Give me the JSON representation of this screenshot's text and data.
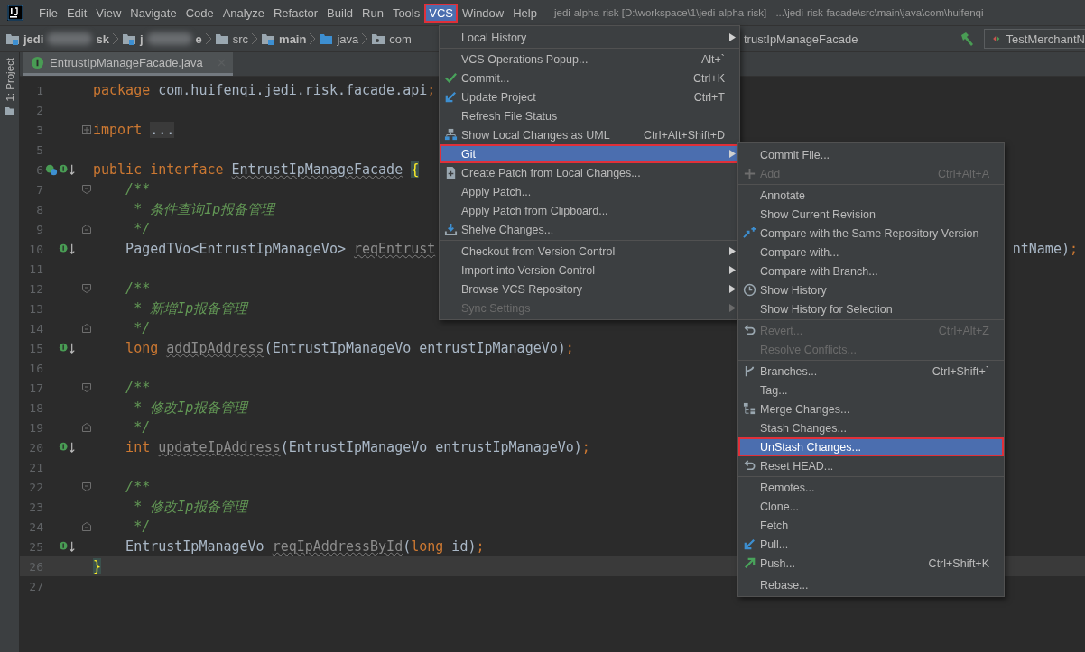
{
  "menubar": {
    "items": [
      {
        "label": "File",
        "selected": false,
        "marked": false
      },
      {
        "label": "Edit",
        "selected": false,
        "marked": false
      },
      {
        "label": "View",
        "selected": false,
        "marked": false
      },
      {
        "label": "Navigate",
        "selected": false,
        "marked": false
      },
      {
        "label": "Code",
        "selected": false,
        "marked": false
      },
      {
        "label": "Analyze",
        "selected": false,
        "marked": false
      },
      {
        "label": "Refactor",
        "selected": false,
        "marked": false
      },
      {
        "label": "Build",
        "selected": false,
        "marked": false
      },
      {
        "label": "Run",
        "selected": false,
        "marked": false
      },
      {
        "label": "Tools",
        "selected": false,
        "marked": false
      },
      {
        "label": "VCS",
        "selected": true,
        "marked": true
      },
      {
        "label": "Window",
        "selected": false,
        "marked": false
      },
      {
        "label": "Help",
        "selected": false,
        "marked": false
      }
    ],
    "title": "jedi-alpha-risk [D:\\workspace\\1\\jedi-alpha-risk] - ...\\jedi-risk-facade\\src\\main\\java\\com\\huifenqi"
  },
  "breadcrumbs": {
    "items": [
      {
        "kind": "module",
        "text": "jedi",
        "text_after": "sk",
        "redacted": true
      },
      {
        "kind": "module",
        "text": "j",
        "text_after": "e",
        "redacted": true
      },
      {
        "kind": "folder",
        "text": "src",
        "redacted": false
      },
      {
        "kind": "module",
        "text": "main",
        "redacted": false
      },
      {
        "kind": "source",
        "text": "java",
        "redacted": false
      },
      {
        "kind": "package",
        "text": "com",
        "redacted": false
      }
    ],
    "tail": "trustIpManageFacade",
    "run_config": "TestMerchantN"
  },
  "sidebar": {
    "tool_window": "1: Project"
  },
  "editor": {
    "tabs": [
      {
        "label": "EntrustIpManageFacade.java",
        "selected": true
      }
    ],
    "lines": [
      {
        "number": "1",
        "current": false,
        "tokens": [
          {
            "kind": "kw",
            "text": "package"
          },
          {
            "kind": "plain",
            "text": " com.huifenqi.jedi.risk.facade.api"
          },
          {
            "kind": "kw",
            "text": ";"
          }
        ]
      },
      {
        "number": "2",
        "current": false
      },
      {
        "number": "3",
        "current": false,
        "fold": {
          "kind": "collapsed"
        },
        "tokens": [
          {
            "kind": "kw",
            "text": "import "
          },
          {
            "kind": "folded",
            "text": "..."
          }
        ]
      },
      {
        "number": "5",
        "current": false
      },
      {
        "number": "6",
        "current": false,
        "gutter": [
          {
            "kind": "hierarchy"
          },
          {
            "kind": "implemented"
          }
        ],
        "tokens": [
          {
            "kind": "kw",
            "text": "public interface "
          },
          {
            "kind": "warn",
            "text": "EntrustIpManageFacade"
          },
          {
            "kind": "brace",
            "text": "{"
          }
        ]
      },
      {
        "number": "7",
        "current": false,
        "fold": {
          "kind": "open"
        },
        "tokens": [
          {
            "kind": "comment",
            "text": "    /**"
          }
        ]
      },
      {
        "number": "8",
        "current": false,
        "tokens": [
          {
            "kind": "comment",
            "text": "     * 条件查询Ip报备管理"
          }
        ]
      },
      {
        "number": "9",
        "current": false,
        "fold": {
          "kind": "close"
        },
        "tokens": [
          {
            "kind": "comment",
            "text": "     */"
          }
        ]
      },
      {
        "number": "10",
        "current": false,
        "gutter": [
          {
            "kind": "implemented"
          }
        ],
        "tokens": [
          {
            "kind": "plain",
            "text": "    PagedTVo<EntrustIpManageVo> "
          },
          {
            "kind": "unused",
            "text": "reqEntrust"
          }
        ],
        "tail": [
          {
            "kind": "plain",
            "text": "ntName)"
          },
          {
            "kind": "kw",
            "text": ";"
          }
        ]
      },
      {
        "number": "11",
        "current": false
      },
      {
        "number": "12",
        "current": false,
        "fold": {
          "kind": "open"
        },
        "tokens": [
          {
            "kind": "comment",
            "text": "    /**"
          }
        ]
      },
      {
        "number": "13",
        "current": false,
        "tokens": [
          {
            "kind": "comment",
            "text": "     * 新增Ip报备管理"
          }
        ]
      },
      {
        "number": "14",
        "current": false,
        "fold": {
          "kind": "close"
        },
        "tokens": [
          {
            "kind": "comment",
            "text": "     */"
          }
        ]
      },
      {
        "number": "15",
        "current": false,
        "gutter": [
          {
            "kind": "implemented"
          }
        ],
        "tokens": [
          {
            "kind": "kw",
            "text": "    long "
          },
          {
            "kind": "unused",
            "text": "addIpAddress"
          },
          {
            "kind": "plain",
            "text": "(EntrustIpManageVo entrustIpManageVo)"
          },
          {
            "kind": "kw",
            "text": ";"
          }
        ]
      },
      {
        "number": "16",
        "current": false
      },
      {
        "number": "17",
        "current": false,
        "fold": {
          "kind": "open"
        },
        "tokens": [
          {
            "kind": "comment",
            "text": "    /**"
          }
        ]
      },
      {
        "number": "18",
        "current": false,
        "tokens": [
          {
            "kind": "comment",
            "text": "     * 修改Ip报备管理"
          }
        ]
      },
      {
        "number": "19",
        "current": false,
        "fold": {
          "kind": "close"
        },
        "tokens": [
          {
            "kind": "comment",
            "text": "     */"
          }
        ]
      },
      {
        "number": "20",
        "current": false,
        "gutter": [
          {
            "kind": "implemented"
          }
        ],
        "tokens": [
          {
            "kind": "kw",
            "text": "    int "
          },
          {
            "kind": "unused",
            "text": "updateIpAddress"
          },
          {
            "kind": "plain",
            "text": "(EntrustIpManageVo entrustIpManageVo)"
          },
          {
            "kind": "kw",
            "text": ";"
          }
        ]
      },
      {
        "number": "21",
        "current": false
      },
      {
        "number": "22",
        "current": false,
        "fold": {
          "kind": "open"
        },
        "tokens": [
          {
            "kind": "comment",
            "text": "    /**"
          }
        ]
      },
      {
        "number": "23",
        "current": false,
        "tokens": [
          {
            "kind": "comment",
            "text": "     * 修改Ip报备管理"
          }
        ]
      },
      {
        "number": "24",
        "current": false,
        "fold": {
          "kind": "close"
        },
        "tokens": [
          {
            "kind": "comment",
            "text": "     */"
          }
        ]
      },
      {
        "number": "25",
        "current": false,
        "gutter": [
          {
            "kind": "implemented"
          }
        ],
        "tokens": [
          {
            "kind": "plain",
            "text": "    EntrustIpManageVo "
          },
          {
            "kind": "unused",
            "text": "reqIpAddressById"
          },
          {
            "kind": "plain",
            "text": "("
          },
          {
            "kind": "kw",
            "text": "long"
          },
          {
            "kind": "plain",
            "text": " id)"
          },
          {
            "kind": "kw",
            "text": ";"
          }
        ]
      },
      {
        "number": "26",
        "current": true,
        "tokens": [
          {
            "kind": "brace",
            "text": "}"
          }
        ]
      },
      {
        "number": "27",
        "current": false
      }
    ]
  },
  "vcs_menu": {
    "items": [
      {
        "kind": "plain",
        "label": "Local History",
        "submenu": true,
        "disabled": false,
        "selected": false,
        "marked": false
      },
      {
        "kind": "separator"
      },
      {
        "kind": "plain",
        "label": "VCS Operations Popup...",
        "shortcut": "Alt+`",
        "submenu": false,
        "disabled": false,
        "selected": false,
        "marked": false
      },
      {
        "kind": "check",
        "label": "Commit...",
        "shortcut": "Ctrl+K",
        "submenu": false,
        "disabled": false,
        "selected": false,
        "marked": false
      },
      {
        "kind": "update",
        "label": "Update Project",
        "shortcut": "Ctrl+T",
        "submenu": false,
        "disabled": false,
        "selected": false,
        "marked": false
      },
      {
        "kind": "plain",
        "label": "Refresh File Status",
        "submenu": false,
        "disabled": false,
        "selected": false,
        "marked": false
      },
      {
        "kind": "uml",
        "label": "Show Local Changes as UML",
        "shortcut": "Ctrl+Alt+Shift+D",
        "submenu": false,
        "disabled": false,
        "selected": false,
        "marked": false
      },
      {
        "kind": "plain",
        "label": "Git",
        "submenu": true,
        "disabled": false,
        "selected": true,
        "marked": true
      },
      {
        "kind": "patch",
        "label": "Create Patch from Local Changes...",
        "submenu": false,
        "disabled": false,
        "selected": false,
        "marked": false
      },
      {
        "kind": "plain",
        "label": "Apply Patch...",
        "submenu": false,
        "disabled": false,
        "selected": false,
        "marked": false
      },
      {
        "kind": "plain",
        "label": "Apply Patch from Clipboard...",
        "submenu": false,
        "disabled": false,
        "selected": false,
        "marked": false
      },
      {
        "kind": "shelve",
        "label": "Shelve Changes...",
        "submenu": false,
        "disabled": false,
        "selected": false,
        "marked": false
      },
      {
        "kind": "separator"
      },
      {
        "kind": "plain",
        "label": "Checkout from Version Control",
        "submenu": true,
        "disabled": false,
        "selected": false,
        "marked": false
      },
      {
        "kind": "plain",
        "label": "Import into Version Control",
        "submenu": true,
        "disabled": false,
        "selected": false,
        "marked": false
      },
      {
        "kind": "plain",
        "label": "Browse VCS Repository",
        "submenu": true,
        "disabled": false,
        "selected": false,
        "marked": false
      },
      {
        "kind": "plain",
        "label": "Sync Settings",
        "submenu": true,
        "disabled": true,
        "selected": false,
        "marked": false
      }
    ]
  },
  "git_submenu": {
    "items": [
      {
        "kind": "plain",
        "label": "Commit File...",
        "submenu": false,
        "disabled": false,
        "selected": false,
        "marked": false
      },
      {
        "kind": "plus",
        "label": "Add",
        "shortcut": "Ctrl+Alt+A",
        "submenu": false,
        "disabled": true,
        "selected": false,
        "marked": false
      },
      {
        "kind": "separator"
      },
      {
        "kind": "plain",
        "label": "Annotate",
        "submenu": false,
        "disabled": false,
        "selected": false,
        "marked": false
      },
      {
        "kind": "plain",
        "label": "Show Current Revision",
        "submenu": false,
        "disabled": false,
        "selected": false,
        "marked": false
      },
      {
        "kind": "compare",
        "label": "Compare with the Same Repository Version",
        "submenu": false,
        "disabled": false,
        "selected": false,
        "marked": false
      },
      {
        "kind": "plain",
        "label": "Compare with...",
        "submenu": false,
        "disabled": false,
        "selected": false,
        "marked": false
      },
      {
        "kind": "plain",
        "label": "Compare with Branch...",
        "submenu": false,
        "disabled": false,
        "selected": false,
        "marked": false
      },
      {
        "kind": "history",
        "label": "Show History",
        "submenu": false,
        "disabled": false,
        "selected": false,
        "marked": false
      },
      {
        "kind": "plain",
        "label": "Show History for Selection",
        "submenu": false,
        "disabled": false,
        "selected": false,
        "marked": false
      },
      {
        "kind": "separator"
      },
      {
        "kind": "revert",
        "label": "Revert...",
        "shortcut": "Ctrl+Alt+Z",
        "submenu": false,
        "disabled": true,
        "selected": false,
        "marked": false
      },
      {
        "kind": "plain",
        "label": "Resolve Conflicts...",
        "submenu": false,
        "disabled": true,
        "selected": false,
        "marked": false
      },
      {
        "kind": "separator"
      },
      {
        "kind": "branch",
        "label": "Branches...",
        "shortcut": "Ctrl+Shift+`",
        "submenu": false,
        "disabled": false,
        "selected": false,
        "marked": false
      },
      {
        "kind": "plain",
        "label": "Tag...",
        "submenu": false,
        "disabled": false,
        "selected": false,
        "marked": false
      },
      {
        "kind": "merge",
        "label": "Merge Changes...",
        "submenu": false,
        "disabled": false,
        "selected": false,
        "marked": false
      },
      {
        "kind": "plain",
        "label": "Stash Changes...",
        "submenu": false,
        "disabled": false,
        "selected": false,
        "marked": false
      },
      {
        "kind": "plain",
        "label": "UnStash Changes...",
        "submenu": false,
        "disabled": false,
        "selected": true,
        "marked": true
      },
      {
        "kind": "revert",
        "label": "Reset HEAD...",
        "submenu": false,
        "disabled": false,
        "selected": false,
        "marked": false
      },
      {
        "kind": "separator"
      },
      {
        "kind": "plain",
        "label": "Remotes...",
        "submenu": false,
        "disabled": false,
        "selected": false,
        "marked": false
      },
      {
        "kind": "plain",
        "label": "Clone...",
        "submenu": false,
        "disabled": false,
        "selected": false,
        "marked": false
      },
      {
        "kind": "plain",
        "label": "Fetch",
        "submenu": false,
        "disabled": false,
        "selected": false,
        "marked": false
      },
      {
        "kind": "update",
        "label": "Pull...",
        "submenu": false,
        "disabled": false,
        "selected": false,
        "marked": false
      },
      {
        "kind": "push",
        "label": "Push...",
        "shortcut": "Ctrl+Shift+K",
        "submenu": false,
        "disabled": false,
        "selected": false,
        "marked": false
      },
      {
        "kind": "separator"
      },
      {
        "kind": "plain",
        "label": "Rebase...",
        "submenu": false,
        "disabled": false,
        "selected": false,
        "marked": false
      }
    ]
  }
}
